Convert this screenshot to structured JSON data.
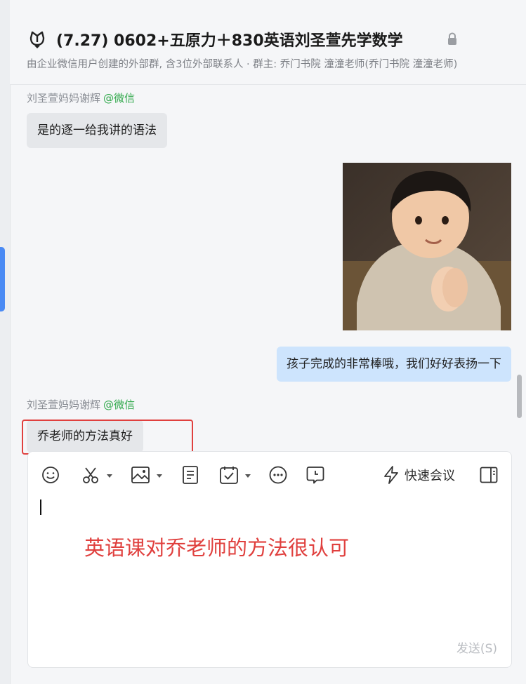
{
  "header": {
    "title": "(7.27) 0602+五原力＋830英语刘圣萱先学数学",
    "subtitle": "由企业微信用户创建的外部群, 含3位外部联系人 · 群主: 乔门书院 潼潼老师(乔门书院 潼潼老师)"
  },
  "messages": [
    {
      "sender": "刘圣萱妈妈谢辉",
      "source": "@微信",
      "text": "是的逐一给我讲的语法"
    },
    {
      "text": "孩子完成的非常棒哦，我们好好表扬一下"
    },
    {
      "sender": "刘圣萱妈妈谢辉",
      "source": "@微信",
      "text": "乔老师的方法真好"
    }
  ],
  "composer": {
    "quick_meeting_label": "快速会议",
    "annotation": "英语课对乔老师的方法很认可",
    "send_label": "发送(S)"
  },
  "colors": {
    "accent": "#4a8af4",
    "outgoing_bubble": "#cde4fd",
    "incoming_bubble": "#e5e7ea",
    "annotation_red": "#e0403e",
    "wechat_green": "#2fa84a"
  },
  "icons": [
    "group-icon",
    "lock-icon",
    "emoji-icon",
    "scissors-icon",
    "image-icon",
    "document-icon",
    "schedule-icon",
    "more-icon",
    "history-icon",
    "lightning-icon",
    "sidebar-toggle-icon"
  ]
}
